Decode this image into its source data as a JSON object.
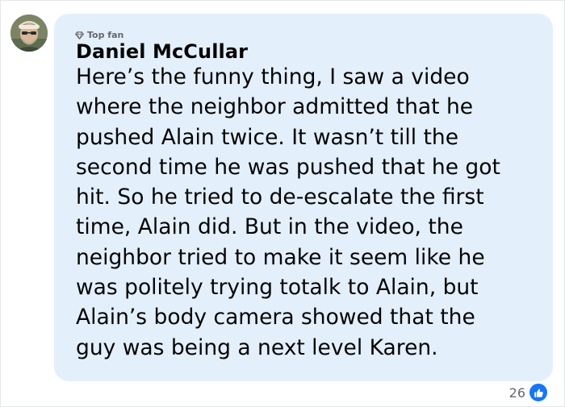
{
  "comment": {
    "author_badge": "Top fan",
    "author_name": "Daniel McCullar",
    "text": "Here’s the funny thing, I saw a video\nwhere the neighbor admitted that he\npushed Alain twice. It wasn’t till the\nsecond time he was pushed that he got\nhit. So he tried to de-escalate the first\ntime, Alain did. But in the video, the\nneighbor tried to make it seem like he\nwas politely trying totalk to Alain, but\nAlain’s body camera showed that the\nguy was being a next level Karen.",
    "reaction_count": "26",
    "reaction_icon": "like-icon",
    "badge_icon": "diamond-icon",
    "bubble_color": "#e4effc",
    "like_color": "#1877f2"
  }
}
